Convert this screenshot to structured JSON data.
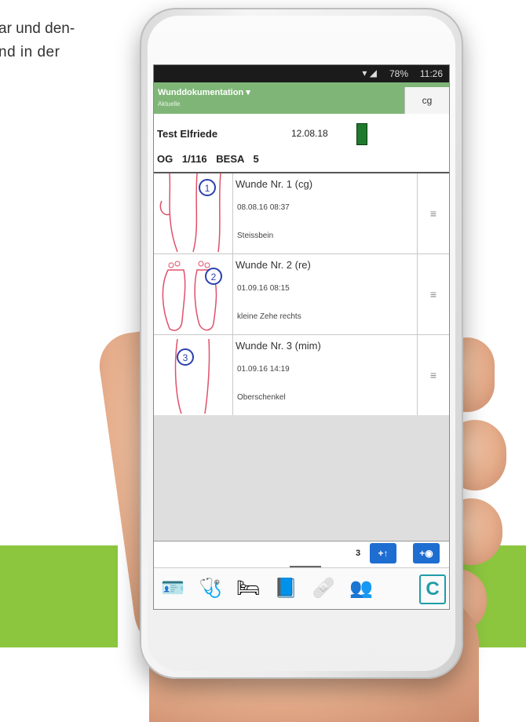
{
  "document_text": {
    "line1": "ar und den-",
    "line2": "nd   in  der"
  },
  "status_bar": {
    "battery": "78%",
    "time": "11:26"
  },
  "app": {
    "title": "Wunddokumentation ▾",
    "subtitle": "Aktuelle",
    "user_initials": "cg"
  },
  "patient": {
    "name": "Test Elfriede",
    "date": "12.08.18",
    "flag_color": "#1f7a2e",
    "ward_room": "OG 1/116",
    "besa": "BESA 5"
  },
  "wounds": [
    {
      "title": "Wunde Nr. 1 (cg)",
      "datetime": "08.08.16 08:37",
      "location": "Steissbein",
      "number": "1"
    },
    {
      "title": "Wunde Nr. 2 (re)",
      "datetime": "01.09.16 08:15",
      "location": "kleine Zehe rechts",
      "number": "2"
    },
    {
      "title": "Wunde Nr. 3 (mim)",
      "datetime": "01.09.16 14:19",
      "location": "Oberschenkel",
      "number": "3"
    }
  ],
  "menu_glyph": "≡",
  "footer": {
    "count": "3",
    "add_label": "+↑",
    "camera_label": "+◉"
  },
  "dock": [
    {
      "icon": "id-card-icon",
      "glyph": "🪪"
    },
    {
      "icon": "stethoscope-icon",
      "glyph": "🩺"
    },
    {
      "icon": "bed-icon",
      "glyph": "🛏"
    },
    {
      "icon": "book-icon",
      "glyph": "📘"
    },
    {
      "icon": "bandage-icon",
      "glyph": "🩹"
    },
    {
      "icon": "users-icon",
      "glyph": "👥"
    },
    {
      "icon": "app-logo-icon",
      "glyph": "C"
    }
  ],
  "colors": {
    "brand_green": "#8cc63f",
    "appbar_green": "#7fb677",
    "button_blue": "#1e6dd1",
    "wound_marker_blue": "#2a3fb0",
    "sketch_red": "#e0506a"
  }
}
